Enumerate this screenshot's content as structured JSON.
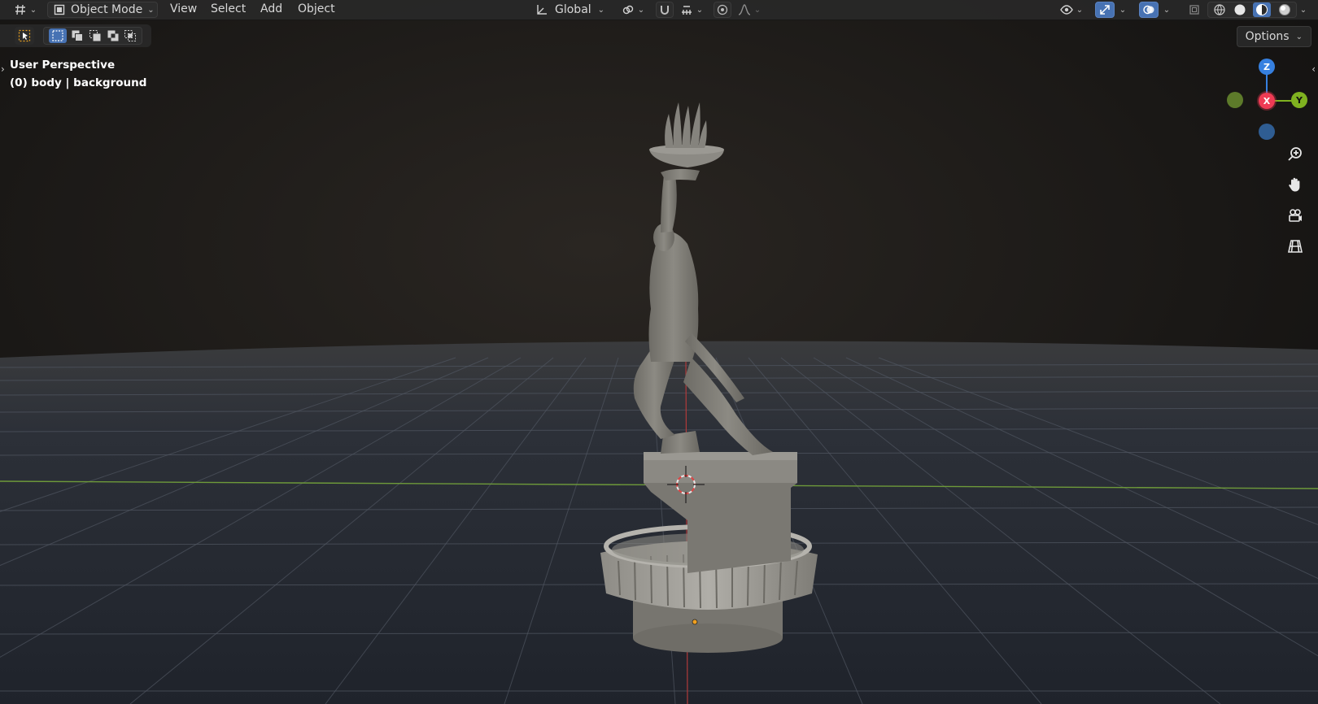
{
  "header": {
    "editor_type_icon": "viewport-grid-icon",
    "mode_label": "Object Mode",
    "menus": [
      "View",
      "Select",
      "Add",
      "Object"
    ],
    "orientation_label": "Global",
    "overlay_icons": [
      "visibility-eye-icon",
      "gizmo-arrow-icon",
      "overlays-icon",
      "xray-icon"
    ],
    "shading_icons": [
      "wireframe-shading-icon",
      "solid-shading-icon",
      "material-shading-icon",
      "rendered-shading-icon"
    ]
  },
  "toolrow": {
    "select_modes": [
      "select-new-icon",
      "select-extend-icon",
      "select-subtract-icon",
      "select-difference-icon",
      "select-intersect-icon"
    ]
  },
  "options_label": "Options",
  "viewport_info": {
    "view_name": "User Perspective",
    "object_info": "(0) body | background"
  },
  "gizmo": {
    "z_label": "Z",
    "x_label": "X",
    "y_label": "Y",
    "colors": {
      "x": "#ee3b54",
      "y": "#7fb220",
      "z": "#3680e0"
    }
  },
  "nav_tools": [
    "zoom-icon",
    "pan-hand-icon",
    "camera-view-icon",
    "orthographic-grid-icon"
  ]
}
